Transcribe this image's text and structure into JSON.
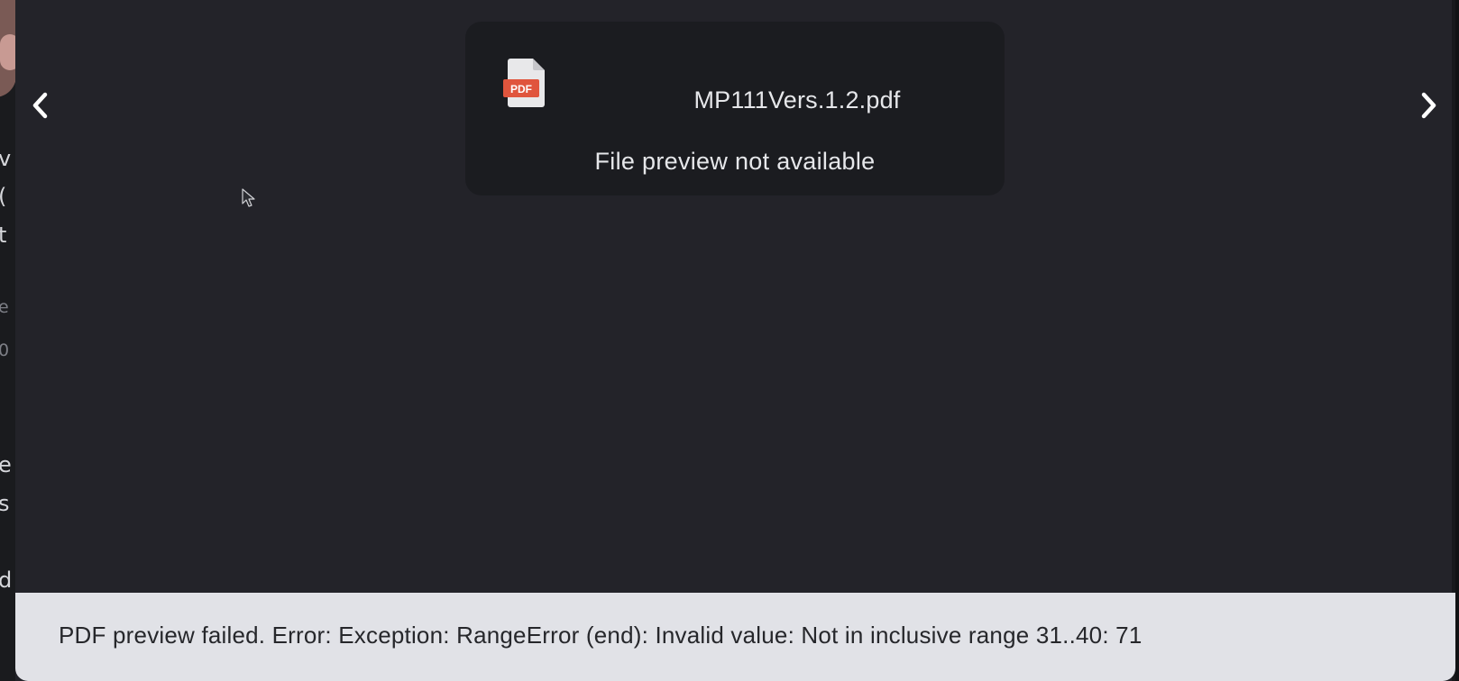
{
  "preview": {
    "file_icon": "pdf-file-icon",
    "file_icon_label": "PDF",
    "file_name": "MP111Vers.1.2.pdf",
    "status_message": "File preview not available"
  },
  "navigation": {
    "prev_icon": "chevron-left-icon",
    "next_icon": "chevron-right-icon"
  },
  "error_bar": {
    "message": "PDF preview failed. Error: Exception: RangeError (end): Invalid value: Not in inclusive range 31..40: 71"
  },
  "colors": {
    "modal_background": "#232329",
    "card_background": "#1b1c20",
    "error_bar_background": "#e1e2e7",
    "pdf_badge": "#e0553d"
  }
}
